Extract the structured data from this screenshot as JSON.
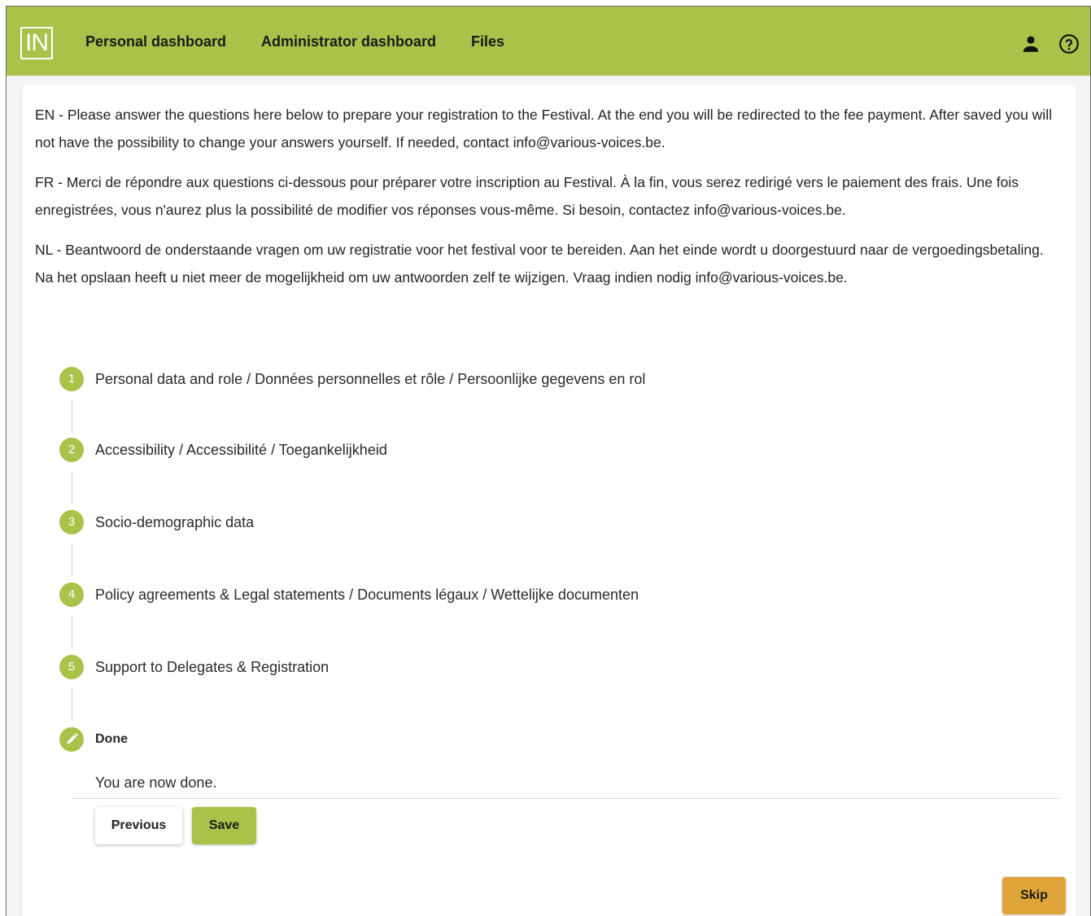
{
  "app": {
    "logo_text": "IN"
  },
  "nav": {
    "items": [
      {
        "label": "Personal dashboard"
      },
      {
        "label": "Administrator dashboard"
      },
      {
        "label": "Files"
      }
    ]
  },
  "icons": {
    "user": "user-icon",
    "help": "help-circle-icon"
  },
  "intro": {
    "en": "EN - Please answer the questions here below to prepare your registration to the Festival. At the end you will be redirected to the fee payment. After saved you will not have the possibility to change your answers yourself. If needed, contact info@various-voices.be.",
    "fr": "FR - Merci de répondre aux questions ci-dessous pour préparer votre inscription au Festival. À la fin, vous serez redirigé vers le paiement des frais. Une fois enregistrées, vous n'aurez plus la possibilité de modifier vos réponses vous-même. Si besoin, contactez info@various-voices.be.",
    "nl": "NL - Beantwoord de onderstaande vragen om uw registratie voor het festival voor te bereiden. Aan het einde wordt u doorgestuurd naar de vergoedingsbetaling. Na het opslaan heeft u niet meer de mogelijkheid om uw antwoorden zelf te wijzigen. Vraag indien nodig info@various-voices.be."
  },
  "stepper": {
    "steps": [
      {
        "number": "1",
        "label": "Personal data and role / Données personnelles et rôle / Persoonlijke gegevens en rol"
      },
      {
        "number": "2",
        "label": "Accessibility / Accessibilité / Toegankelijkheid"
      },
      {
        "number": "3",
        "label": "Socio-demographic data"
      },
      {
        "number": "4",
        "label": "Policy agreements & Legal statements / Documents légaux / Wettelijke documenten"
      },
      {
        "number": "5",
        "label": "Support to Delegates & Registration"
      },
      {
        "number": "",
        "label": "Done",
        "icon": "pencil-icon",
        "active": true
      }
    ],
    "done_message": "You are now done."
  },
  "buttons": {
    "previous": "Previous",
    "save": "Save",
    "skip": "Skip"
  },
  "colors": {
    "accent": "#a8c24a",
    "skip": "#e0a53a"
  }
}
